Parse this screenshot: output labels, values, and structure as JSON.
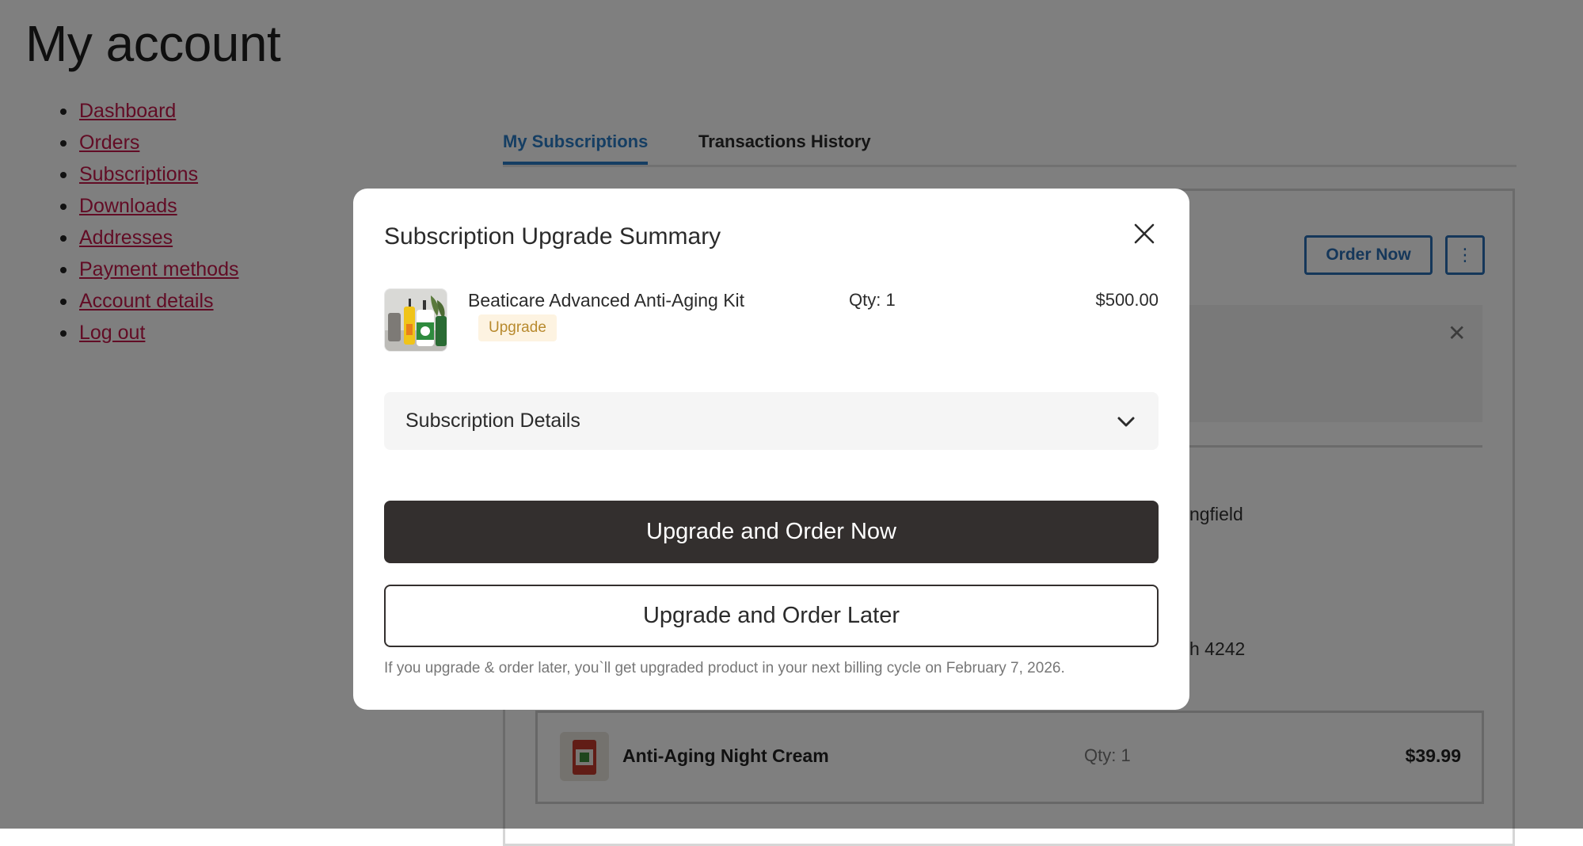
{
  "page": {
    "title": "My account",
    "nav": [
      "Dashboard",
      "Orders",
      "Subscriptions",
      "Downloads",
      "Addresses",
      "Payment methods",
      "Account details",
      "Log out"
    ],
    "tabs": {
      "active": "My Subscriptions",
      "inactive": "Transactions History"
    },
    "order_now_label": "Order Now",
    "more_label": "⋮",
    "address_fragment": "ngfield",
    "card_fragment": "h 4242",
    "item": {
      "name": "Anti-Aging Night Cream",
      "qty": "Qty: 1",
      "price": "$39.99"
    }
  },
  "modal": {
    "title": "Subscription Upgrade Summary",
    "product": {
      "name": "Beaticare Advanced Anti-Aging Kit",
      "badge": "Upgrade",
      "qty": "Qty: 1",
      "price": "$500.00"
    },
    "details_label": "Subscription Details",
    "primary_button": "Upgrade and Order Now",
    "secondary_button": "Upgrade and Order Later",
    "footnote": "If you upgrade & order later, you`ll get upgraded product in your next billing cycle on February 7, 2026."
  },
  "icons": {
    "close": "close-icon",
    "chevron": "chevron-down-icon",
    "product_image": "product-image"
  },
  "colors": {
    "primary_button": "#332f2e",
    "badge_bg": "#fdf3e1",
    "badge_text": "#b88a2e",
    "link": "#c4184a",
    "tab_active": "#2a7cc7"
  }
}
